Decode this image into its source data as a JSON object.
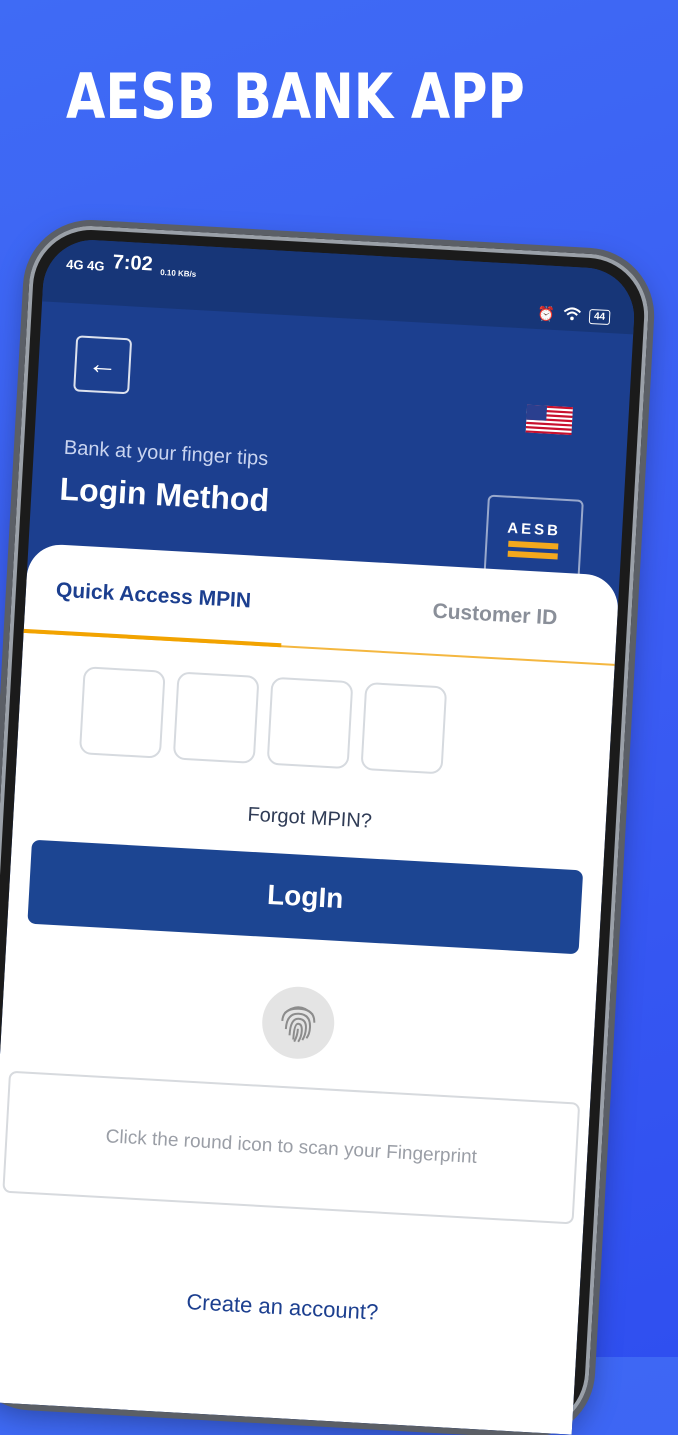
{
  "headline": "AESB BANK APP",
  "status_bar": {
    "network": "4G 4G",
    "time": "7:02",
    "speed": "0.10 KB/s",
    "battery": "44"
  },
  "header": {
    "tagline": "Bank at your finger tips",
    "title": "Login Method",
    "logo_text": "AESB"
  },
  "tabs": [
    {
      "label": "Quick Access MPIN",
      "active": true
    },
    {
      "label": "Customer ID",
      "active": false
    }
  ],
  "forgot_label": "Forgot MPIN?",
  "login_label": "LogIn",
  "fingerprint_hint": "Click the round icon to scan your Fingerprint",
  "create_account_label": "Create an account?",
  "colors": {
    "background": "#3a5cf3",
    "header_blue": "#1c3f8f",
    "button_blue": "#1c4592",
    "accent_orange": "#f2a300"
  }
}
